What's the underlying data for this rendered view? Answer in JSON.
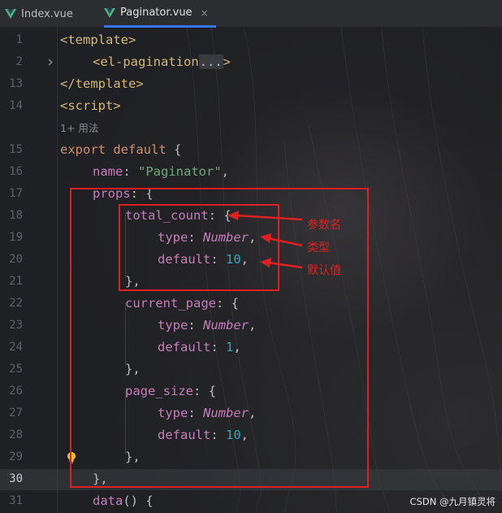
{
  "tabs": [
    {
      "label": "Index.vue",
      "active": false,
      "icon": "vue-icon"
    },
    {
      "label": "Paginator.vue",
      "active": true,
      "icon": "vue-icon",
      "close": "×"
    }
  ],
  "colors": {
    "vue": "#42b883",
    "annotation": "#e02020",
    "accent": "#3574f0"
  },
  "editor": {
    "lines": [
      {
        "num": "1",
        "content": [
          "<template>"
        ]
      },
      {
        "num": "2",
        "content": [
          "<el-pagination",
          "...",
          ">"
        ],
        "folded": true
      },
      {
        "num": "13",
        "content": [
          "</template>"
        ]
      },
      {
        "num": "14",
        "content": [
          "<script>"
        ]
      },
      {
        "num": "",
        "content": [
          "1+ 用法"
        ]
      },
      {
        "num": "15",
        "content": [
          "export",
          "default",
          "{"
        ]
      },
      {
        "num": "16",
        "content": [
          "name",
          ": ",
          "\"Paginator\"",
          ","
        ]
      },
      {
        "num": "17",
        "content": [
          "props",
          ": {"
        ]
      },
      {
        "num": "18",
        "content": [
          "total_count",
          ": {"
        ]
      },
      {
        "num": "19",
        "content": [
          "type",
          ": ",
          "Number",
          ","
        ]
      },
      {
        "num": "20",
        "content": [
          "default",
          ": ",
          "10",
          ","
        ]
      },
      {
        "num": "21",
        "content": [
          "},"
        ]
      },
      {
        "num": "22",
        "content": [
          "current_page",
          ": {"
        ]
      },
      {
        "num": "23",
        "content": [
          "type",
          ": ",
          "Number",
          ","
        ]
      },
      {
        "num": "24",
        "content": [
          "default",
          ": ",
          "1",
          ","
        ]
      },
      {
        "num": "25",
        "content": [
          "},"
        ]
      },
      {
        "num": "26",
        "content": [
          "page_size",
          ": {"
        ]
      },
      {
        "num": "27",
        "content": [
          "type",
          ": ",
          "Number",
          ","
        ]
      },
      {
        "num": "28",
        "content": [
          "default",
          ": ",
          "10",
          ","
        ]
      },
      {
        "num": "29",
        "content": [
          "},"
        ]
      },
      {
        "num": "30",
        "content": [
          "},"
        ],
        "current": true
      },
      {
        "num": "31",
        "content": [
          "data",
          "() {"
        ]
      }
    ]
  },
  "annotations": {
    "param_name": "参数名",
    "type": "类型",
    "default_value": "默认值"
  },
  "watermark": "CSDN @九月镇灵将"
}
